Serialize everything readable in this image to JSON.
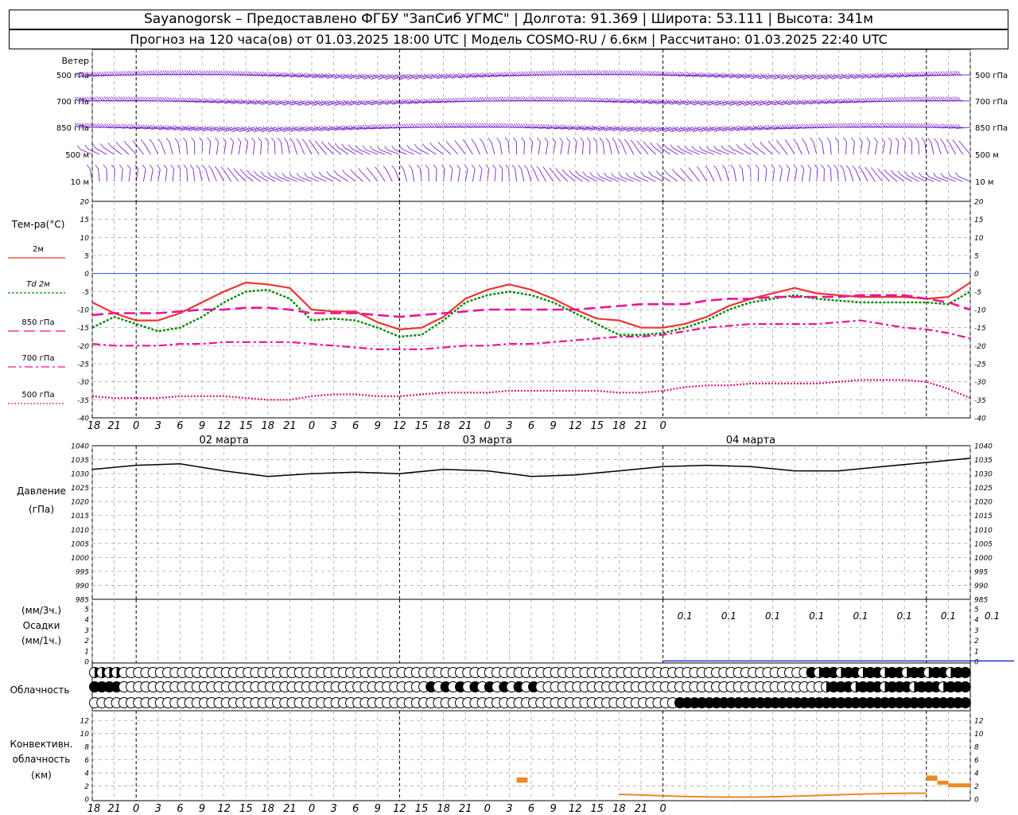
{
  "header": {
    "line1": "Sayanogorsk – Предоставлено ФГБУ \"ЗапСиб УГМС\" | Долгота: 91.369 | Широта: 53.111 | Высота: 341м",
    "line2": "Прогноз на 120 часа(ов) от 01.03.2025 18:00 UTC  | Модель COSMO-RU / 6.6км | Рассчитано: 01.03.2025 22:40 UTC"
  },
  "labels": {
    "wind": "Ветер",
    "wind_levels": [
      "500 гПа",
      "700 гПа",
      "850 гПа",
      "500 м",
      "10  м"
    ],
    "temp_title": "Тем-ра(°C)",
    "temp_legend": [
      "2м",
      "Td  2м",
      "850 гПа",
      "700 гПа",
      "500 гПа"
    ],
    "pressure_title": "Давление",
    "pressure_unit": "(гПа)",
    "precip_units_top": "(мм/3ч.)",
    "precip_title": "Осадки",
    "precip_units_bottom": "(мм/1ч.)",
    "cloud_title": "Облачность",
    "conv_title_1": "Конвективн.",
    "conv_title_2": "облачность",
    "conv_unit": "(км)"
  },
  "time_axis": {
    "hour_labels": [
      "18",
      "21",
      "0",
      "3",
      "6",
      "9",
      "12",
      "15",
      "18",
      "21",
      "0",
      "3",
      "6",
      "9",
      "12",
      "15",
      "18",
      "21",
      "0",
      "3",
      "6",
      "9",
      "12",
      "15",
      "18",
      "21",
      "0"
    ],
    "day_labels": [
      "02 марта",
      "03 марта",
      "04 марта"
    ]
  },
  "colors": {
    "t2m": "#ee3333",
    "td2m": "#008800",
    "t850": "#ee1199",
    "t700": "#ee1199",
    "t500": "#dd1177",
    "wind": "#7722cc",
    "pressure": "#000000",
    "precip": "#2233cc",
    "convective": "#ee8822",
    "zero_line": "#3355ee"
  },
  "chart_data": [
    {
      "type": "line",
      "title": "Тем-ра(°C)",
      "x_unit": "hours since forecast start",
      "x": [
        0,
        3,
        6,
        9,
        12,
        15,
        18,
        21,
        24,
        27,
        30,
        33,
        36,
        39,
        42,
        45,
        48,
        51,
        54,
        57,
        60,
        63,
        66,
        69,
        72,
        75,
        78,
        81,
        84,
        87,
        90,
        93,
        96,
        99,
        102,
        105,
        108,
        111,
        114,
        117,
        120
      ],
      "ylim": [
        -40,
        20
      ],
      "yticks": [
        -40,
        -35,
        -30,
        -25,
        -20,
        -15,
        -10,
        -5,
        0,
        5,
        10,
        15,
        20
      ],
      "series": [
        {
          "name": "2м",
          "values": [
            -8,
            -11,
            -13,
            -13,
            -11,
            -8,
            -5,
            -2.5,
            -3,
            -4,
            -10,
            -10.5,
            -10.5,
            -13.5,
            -15.5,
            -15,
            -12,
            -7,
            -4.5,
            -3,
            -4.5,
            -7,
            -10,
            -12.5,
            -13,
            -15,
            -15,
            -14,
            -12,
            -9,
            -7,
            -5.5,
            -4,
            -5.5,
            -6,
            -6.5,
            -6.5,
            -6.5,
            -7,
            -6.5,
            -2.5
          ]
        },
        {
          "name": "Td  2м",
          "values": [
            -15,
            -12,
            -14,
            -16,
            -15,
            -12,
            -8,
            -5,
            -4.5,
            -7,
            -13,
            -12.5,
            -13,
            -15,
            -17.5,
            -17,
            -13,
            -8,
            -6,
            -5,
            -6,
            -8,
            -11,
            -14,
            -17,
            -17,
            -16.5,
            -15,
            -13,
            -10,
            -8,
            -7,
            -6,
            -7,
            -7.5,
            -8,
            -8,
            -8,
            -8,
            -8.5,
            -5
          ]
        },
        {
          "name": "850 гПа",
          "values": [
            -11.5,
            -11,
            -11,
            -11,
            -10.5,
            -10,
            -10,
            -9.5,
            -9.5,
            -10,
            -11,
            -11,
            -11,
            -11.5,
            -12,
            -11.5,
            -11,
            -10.5,
            -10,
            -10,
            -10,
            -10,
            -10,
            -9.5,
            -9,
            -8.5,
            -8.5,
            -8.5,
            -7.5,
            -7,
            -7,
            -6.5,
            -6.5,
            -6.5,
            -6.5,
            -6,
            -6,
            -6,
            -7,
            -8,
            -10
          ]
        },
        {
          "name": "700 гПа",
          "values": [
            -19.5,
            -20,
            -20,
            -20,
            -19.5,
            -19.5,
            -19,
            -19,
            -19,
            -19,
            -19.5,
            -20,
            -20.5,
            -21,
            -21,
            -21,
            -20.5,
            -20,
            -20,
            -19.5,
            -19.5,
            -19,
            -18.5,
            -18,
            -17.5,
            -17.5,
            -17,
            -16,
            -15,
            -14.5,
            -14,
            -14,
            -14,
            -14,
            -13.5,
            -13,
            -14,
            -15,
            -15.5,
            -16.5,
            -18
          ]
        },
        {
          "name": "500 гПа",
          "values": [
            -34,
            -34.5,
            -34.5,
            -34.5,
            -34,
            -34,
            -34,
            -34.5,
            -35,
            -35,
            -34,
            -33.5,
            -33.5,
            -34,
            -34,
            -33.5,
            -33,
            -33,
            -33,
            -32.5,
            -32.5,
            -32.5,
            -32.5,
            -32.5,
            -33,
            -33,
            -32.5,
            -31.5,
            -31,
            -31,
            -30.5,
            -30.5,
            -30.5,
            -30.5,
            -30,
            -29.5,
            -29.5,
            -29.5,
            -30,
            -32,
            -34.5
          ]
        }
      ]
    },
    {
      "type": "line",
      "title": "Давление",
      "ylabel": "(гПа)",
      "ylim": [
        985,
        1040
      ],
      "yticks": [
        985,
        990,
        995,
        1000,
        1005,
        1010,
        1015,
        1020,
        1025,
        1030,
        1035,
        1040
      ],
      "x": [
        0,
        6,
        12,
        18,
        24,
        30,
        36,
        42,
        48,
        54,
        60,
        66,
        72,
        78,
        84,
        90,
        96,
        102,
        108,
        114,
        120
      ],
      "series": [
        {
          "name": "Давление",
          "values": [
            1031.5,
            1033,
            1033.5,
            1031,
            1029,
            1030,
            1030.5,
            1030,
            1031.5,
            1031,
            1029,
            1029.5,
            1031,
            1032.5,
            1033,
            1032.5,
            1031,
            1031,
            1032.5,
            1034,
            1035.5
          ]
        }
      ]
    },
    {
      "type": "bar",
      "title": "Осадки",
      "ylim": [
        0,
        5
      ],
      "yticks": [
        0,
        1,
        2,
        3,
        4,
        5
      ],
      "data_labels": [
        "0.1",
        "0.1",
        "0.1",
        "0.1",
        "0.1",
        "0.1",
        "0.1",
        "0.1"
      ],
      "x": [
        87,
        93,
        99,
        105,
        111,
        117,
        123,
        129
      ],
      "values": [
        0.1,
        0.1,
        0.1,
        0.1,
        0.1,
        0.1,
        0.1,
        0.1
      ]
    },
    {
      "type": "bar",
      "title": "Конвективн. облачность",
      "ylabel": "(км)",
      "ylim": [
        0,
        13
      ],
      "yticks": [
        0,
        2,
        4,
        6,
        8,
        10,
        12
      ],
      "segments": [
        {
          "x0": 58,
          "x1": 59.5,
          "bottom": 2.5,
          "top": 3.3
        },
        {
          "x0": 114,
          "x1": 115.5,
          "bottom": 2.8,
          "top": 3.6
        },
        {
          "x0": 115.5,
          "x1": 117,
          "bottom": 2.2,
          "top": 2.8
        },
        {
          "x0": 117,
          "x1": 120,
          "bottom": 1.8,
          "top": 2.4
        }
      ]
    }
  ]
}
